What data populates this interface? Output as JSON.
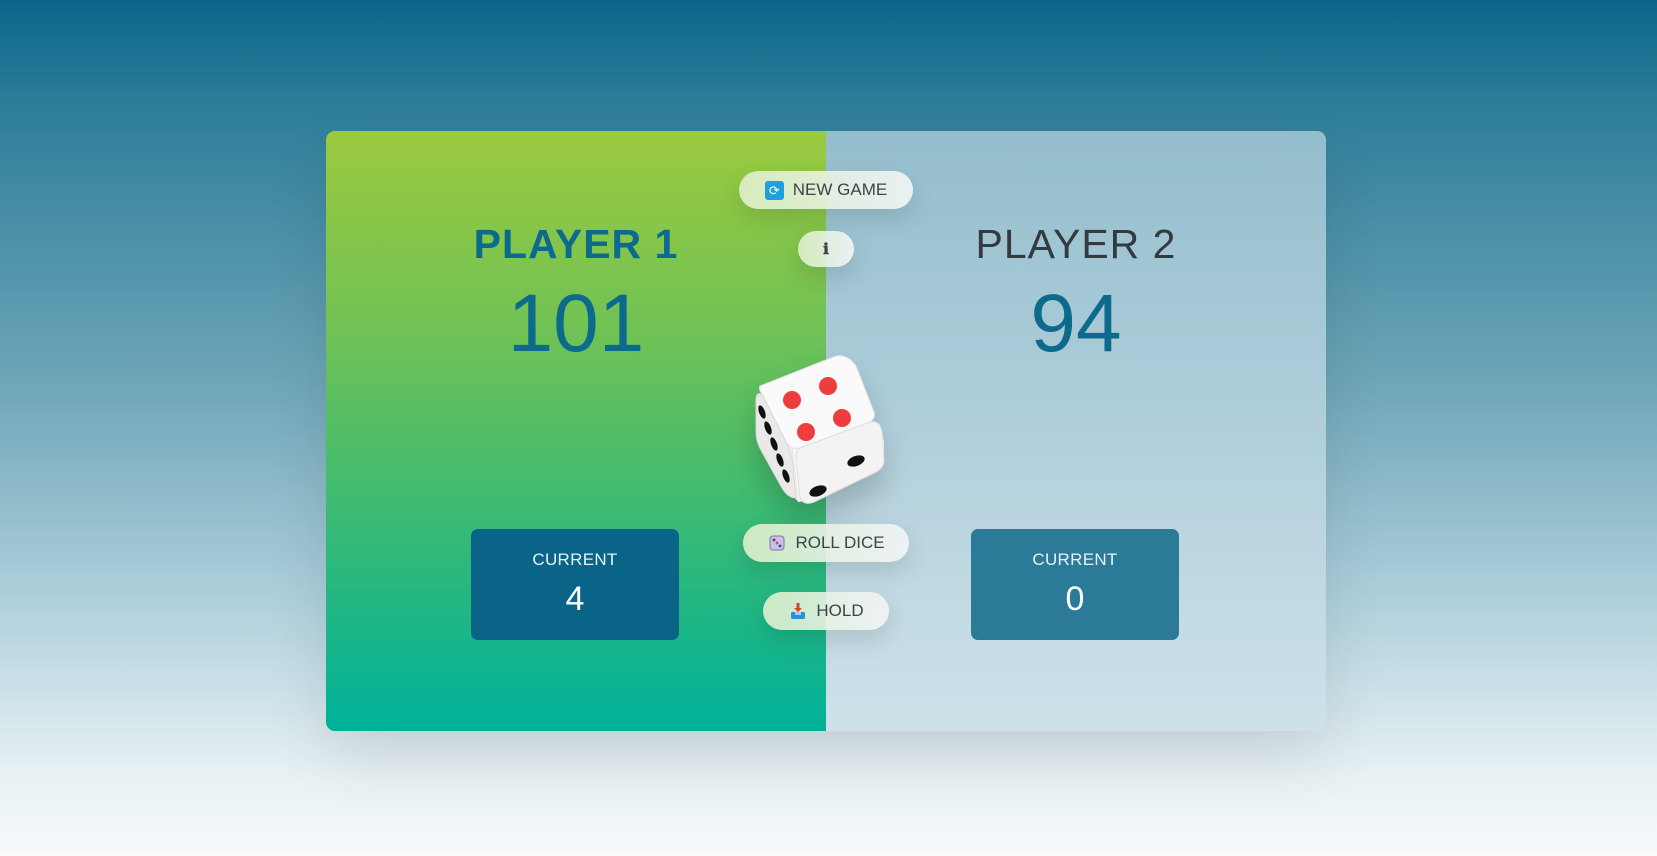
{
  "players": [
    {
      "name": "PLAYER 1",
      "score": "101",
      "current_label": "CURRENT",
      "current": "4",
      "active": true
    },
    {
      "name": "PLAYER 2",
      "score": "94",
      "current_label": "CURRENT",
      "current": "0",
      "active": false
    }
  ],
  "controls": {
    "new_game_label": "NEW GAME",
    "info_label": "ℹ",
    "roll_label": "ROLL DICE",
    "hold_label": "HOLD"
  },
  "dice": {
    "value": 4,
    "icon": "dice-icon"
  },
  "icons": {
    "new_game": "refresh-icon",
    "roll": "die-emoji-icon",
    "hold": "inbox-tray-icon"
  },
  "colors": {
    "active_score": "#0c6b8d",
    "current_box_active": "#0a6487",
    "current_box_inactive": "#2b7b98",
    "pip": "#ef3c3c"
  }
}
